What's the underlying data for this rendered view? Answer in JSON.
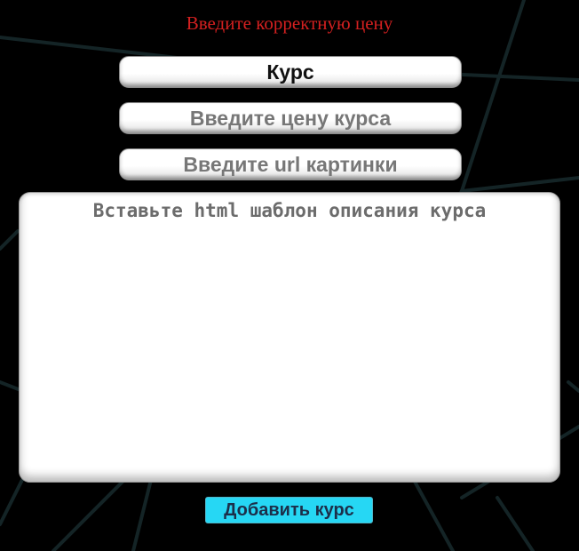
{
  "form": {
    "error_message": "Введите корректную цену",
    "title_value": "Курс",
    "price_placeholder": "Введите цену курса",
    "image_url_placeholder": "Введите url картинки",
    "description_placeholder": "Вставьте html шаблон описания курса",
    "submit_label": "Добавить курс"
  },
  "colors": {
    "background": "#000000",
    "error": "#d42020",
    "button": "#26d7f4",
    "button_text": "#1c2f4a"
  }
}
